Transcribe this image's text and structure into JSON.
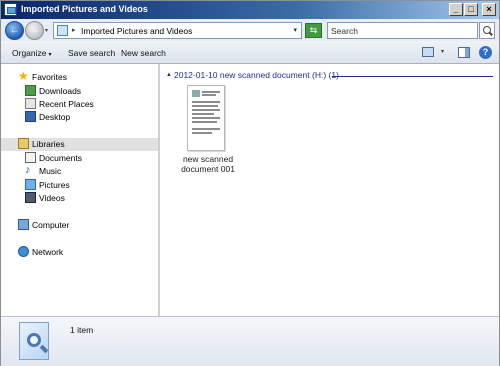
{
  "window": {
    "title": "Imported Pictures and Videos",
    "controls": {
      "minimize": "_",
      "maximize": "□",
      "close": "×"
    }
  },
  "addressbar": {
    "back_glyph": "←",
    "forward_glyph": "→",
    "separator": "▸",
    "path": "Imported Pictures and Videos",
    "refresh_glyph": "⇆",
    "search_placeholder": "Search"
  },
  "toolbar": {
    "organize_label": "Organize",
    "organize_caret": "▾",
    "save_search_label": "Save search",
    "new_search_label": "New search",
    "views_caret": "▾",
    "help_glyph": "?"
  },
  "sidebar": {
    "favorites": {
      "label": "Favorites",
      "items": [
        {
          "label": "Downloads",
          "icon": "downloads-icon"
        },
        {
          "label": "Recent Places",
          "icon": "recent-places-icon"
        },
        {
          "label": "Desktop",
          "icon": "desktop-icon"
        }
      ]
    },
    "libraries": {
      "label": "Libraries",
      "items": [
        {
          "label": "Documents",
          "icon": "documents-icon"
        },
        {
          "label": "Music",
          "icon": "music-icon"
        },
        {
          "label": "Pictures",
          "icon": "pictures-icon"
        },
        {
          "label": "Videos",
          "icon": "videos-icon"
        }
      ]
    },
    "computer": {
      "label": "Computer"
    },
    "network": {
      "label": "Network"
    }
  },
  "content": {
    "group": {
      "caret": "▲",
      "title": "2012-01-10 new scanned document (H:) (1)"
    },
    "files": [
      {
        "name_line1": "new scanned",
        "name_line2": "document 001"
      }
    ]
  },
  "details": {
    "item_count": "1 item"
  },
  "colors": {
    "titlebar_start": "#0a246a",
    "selected_row": "#e1e1e1",
    "group_header": "#1e3287"
  }
}
